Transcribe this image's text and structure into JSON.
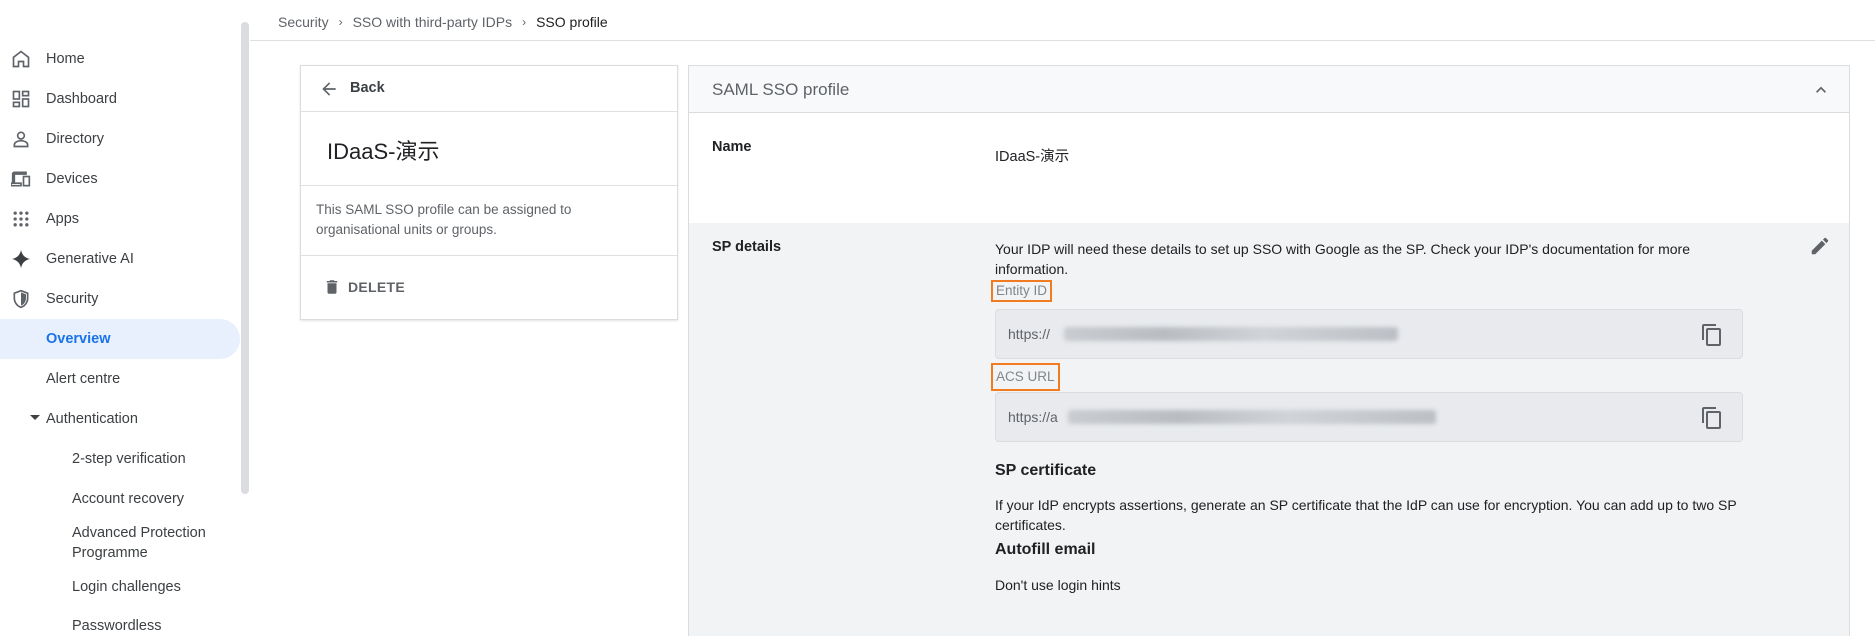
{
  "sidebar": {
    "items": [
      {
        "label": "Home",
        "icon": "home-icon"
      },
      {
        "label": "Dashboard",
        "icon": "dashboard-icon"
      },
      {
        "label": "Directory",
        "icon": "person-icon"
      },
      {
        "label": "Devices",
        "icon": "devices-icon"
      },
      {
        "label": "Apps",
        "icon": "apps-grid-icon"
      },
      {
        "label": "Generative AI",
        "icon": "sparkle-icon"
      },
      {
        "label": "Security",
        "icon": "shield-icon"
      },
      {
        "label": "Overview"
      },
      {
        "label": "Alert centre"
      },
      {
        "label": "Authentication"
      },
      {
        "label": "2-step verification"
      },
      {
        "label": "Account recovery"
      },
      {
        "label": "Advanced Protection Programme"
      },
      {
        "label": "Login challenges"
      },
      {
        "label": "Passwordless"
      }
    ]
  },
  "breadcrumb": {
    "items": [
      "Security",
      "SSO with third-party IDPs",
      "SSO profile"
    ]
  },
  "left_card": {
    "back_label": "Back",
    "profile_name": "IDaaS-演示",
    "description": "This SAML SSO profile can be assigned to organisational units or groups.",
    "delete_label": "DELETE"
  },
  "right_card": {
    "title": "SAML SSO profile",
    "name_label": "Name",
    "name_value": "IDaaS-演示",
    "sp_label": "SP details",
    "sp_description": "Your IDP will need these details to set up SSO with Google as the SP. Check your IDP's documentation for more information.",
    "entity_id_label": "Entity ID",
    "entity_id_value": "https://",
    "acs_url_label": "ACS URL",
    "acs_url_value": "https://a",
    "sp_cert_heading": "SP certificate",
    "sp_cert_text": "If your IdP encrypts assertions, generate an SP certificate that the IdP can use for encryption. You can add up to two SP certificates.",
    "autofill_heading": "Autofill email",
    "autofill_text": "Don't use login hints"
  },
  "colors": {
    "accent": "#1a73e8",
    "active_bg": "#e8f0fe",
    "highlight_border": "#f07b21"
  }
}
